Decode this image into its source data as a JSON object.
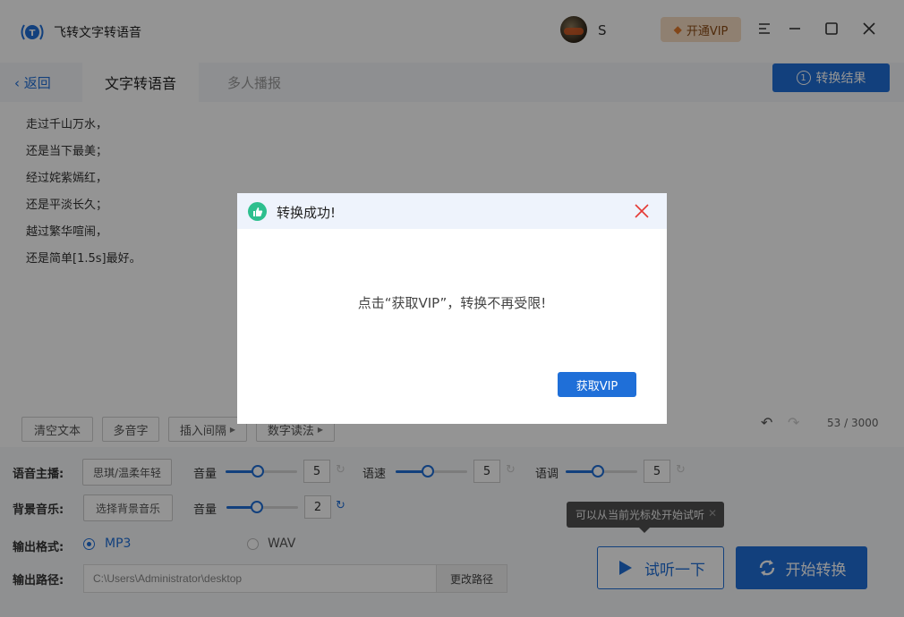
{
  "app": {
    "title": "飞转文字转语音",
    "username": "S",
    "vip_label": "开通VIP"
  },
  "nav": {
    "back_label": "返回",
    "tabs": [
      {
        "label": "文字转语音"
      },
      {
        "label": "多人播报"
      }
    ],
    "result_num": "1",
    "result_label": "转换结果"
  },
  "editor": {
    "lines": [
      "走过千山万水，",
      "还是当下最美；",
      "经过姹紫嫣红，",
      "还是平淡长久；",
      "越过繁华喧闹，",
      "还是简单[1.5s]最好。"
    ],
    "toolbar": {
      "clear": "清空文本",
      "polyphone": "多音字",
      "insert_pause": "插入间隔",
      "digit_reading": "数字读法"
    },
    "count": "53 / 3000"
  },
  "settings": {
    "anchor_label": "语音主播:",
    "anchor_value": "思琪/温柔年轻",
    "volume_label": "音量",
    "volume": 5,
    "volume_fraction": 0.45,
    "speed_label": "语速",
    "speed": 5,
    "speed_fraction": 0.45,
    "pitch_label": "语调",
    "pitch": 5,
    "pitch_fraction": 0.45,
    "bgm_label": "背景音乐:",
    "bgm_button": "选择背景音乐",
    "bgm_volume_label": "音量",
    "bgm_volume": 2,
    "bgm_volume_fraction": 0.42,
    "format_label": "输出格式:",
    "format_mp3": "MP3",
    "format_wav": "WAV",
    "path_label": "输出路径:",
    "path_value": "C:\\Users\\Administrator\\desktop",
    "path_button": "更改路径",
    "tooltip": "可以从当前光标处开始试听",
    "listen_button": "试听一下",
    "start_button": "开始转换"
  },
  "dialog": {
    "title": "转换成功!",
    "message": "点击“获取VIP”，转换不再受限!",
    "vip_button": "获取VIP"
  },
  "colors": {
    "accent": "#1f6fd8",
    "success": "#2dbf8e",
    "close": "#e53935"
  }
}
